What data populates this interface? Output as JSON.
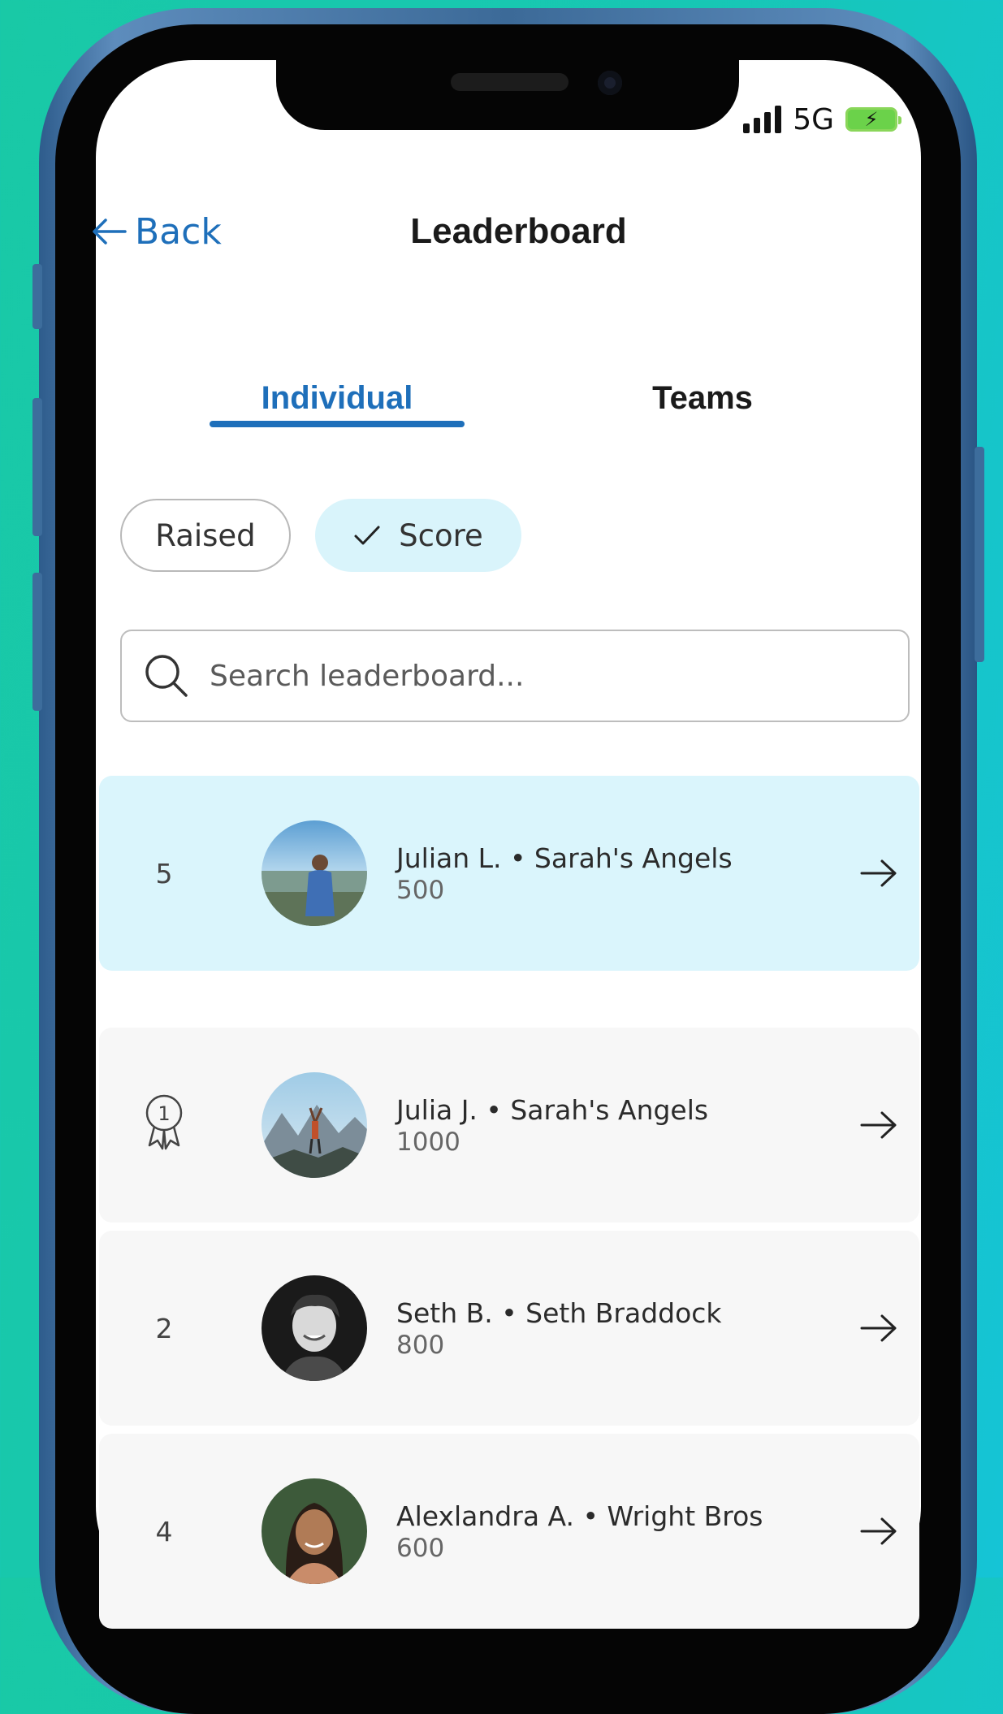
{
  "status_bar": {
    "network": "5G"
  },
  "nav": {
    "back_label": "Back",
    "title": "Leaderboard"
  },
  "tabs": [
    {
      "label": "Individual",
      "active": true
    },
    {
      "label": "Teams",
      "active": false
    }
  ],
  "filters": [
    {
      "label": "Raised",
      "selected": false
    },
    {
      "label": "Score",
      "selected": true
    }
  ],
  "search": {
    "placeholder": "Search leaderboard..."
  },
  "current_user": {
    "rank": "5",
    "name": "Julian L. • Sarah's Angels",
    "score": "500"
  },
  "leaderboard": [
    {
      "rank": "1",
      "rank_icon": "award-ribbon-icon",
      "name": "Julia J. • Sarah's Angels",
      "score": "1000"
    },
    {
      "rank": "2",
      "name": "Seth B. • Seth Braddock",
      "score": "800"
    },
    {
      "rank": "4",
      "name": "Alexlandra A. • Wright Bros",
      "score": "600"
    }
  ],
  "colors": {
    "accent": "#1e6fba",
    "highlight_row": "#daf5fc",
    "background": "#19c9a6"
  }
}
